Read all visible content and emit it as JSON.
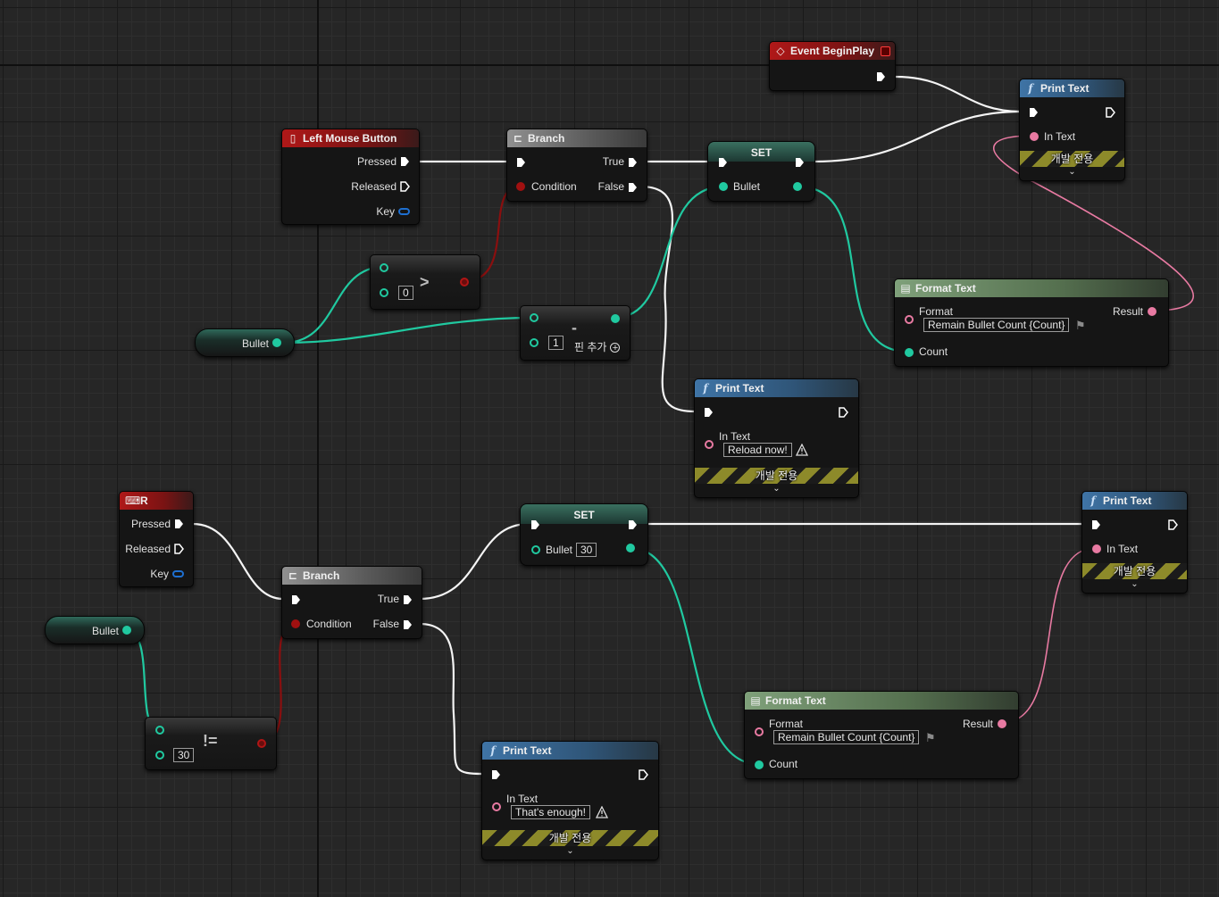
{
  "nodes": {
    "event_beginplay": {
      "title": "Event BeginPlay"
    },
    "lmb": {
      "title": "Left Mouse Button",
      "pressed": "Pressed",
      "released": "Released",
      "key": "Key"
    },
    "branch_top": {
      "title": "Branch",
      "condition": "Condition",
      "true_label": "True",
      "false_label": "False"
    },
    "set_top": {
      "title": "SET",
      "var": "Bullet"
    },
    "print_top_right": {
      "title": "Print Text",
      "in_text": "In Text",
      "dev_only": "개발 전용"
    },
    "greater": {
      "op": ">",
      "value": "0"
    },
    "subtract": {
      "op": "-",
      "value": "1",
      "add_pin": "핀 추가"
    },
    "bullet_get_top": {
      "label": "Bullet"
    },
    "format_top": {
      "title": "Format Text",
      "format_label": "Format",
      "format_value": "Remain Bullet Count {Count}",
      "result": "Result",
      "count": "Count"
    },
    "print_reload": {
      "title": "Print Text",
      "in_text": "In Text",
      "value": "Reload now!",
      "dev_only": "개발 전용"
    },
    "r_key": {
      "title": "R",
      "pressed": "Pressed",
      "released": "Released",
      "key": "Key"
    },
    "set_bottom": {
      "title": "SET",
      "var": "Bullet",
      "value": "30"
    },
    "print_bottom_right": {
      "title": "Print Text",
      "in_text": "In Text",
      "dev_only": "개발 전용"
    },
    "branch_bottom": {
      "title": "Branch",
      "condition": "Condition",
      "true_label": "True",
      "false_label": "False"
    },
    "bullet_get_bottom": {
      "label": "Bullet"
    },
    "not_equal": {
      "op": "!=",
      "value": "30"
    },
    "format_bottom": {
      "title": "Format Text",
      "format_label": "Format",
      "format_value": "Remain Bullet Count {Count}",
      "result": "Result",
      "count": "Count"
    },
    "print_enough": {
      "title": "Print Text",
      "in_text": "In Text",
      "value": "That's enough!",
      "dev_only": "개발 전용"
    }
  },
  "colors": {
    "exec_wire": "#ffffff",
    "int_wire": "#20c9a0",
    "bool_wire": "#8a0f0f",
    "text_wire": "#e87aa2",
    "event_header": "#b01818",
    "function_header": "#3f74a6",
    "format_header": "#7fa07a"
  },
  "icons": {
    "event": "event-diamond-icon",
    "mouse": "mouse-icon",
    "keyboard": "keyboard-icon",
    "branch": "branch-icon",
    "function": "function-f-icon",
    "format": "format-text-icon",
    "warning": "warning-icon",
    "breakpoint": "breakpoint-icon"
  }
}
